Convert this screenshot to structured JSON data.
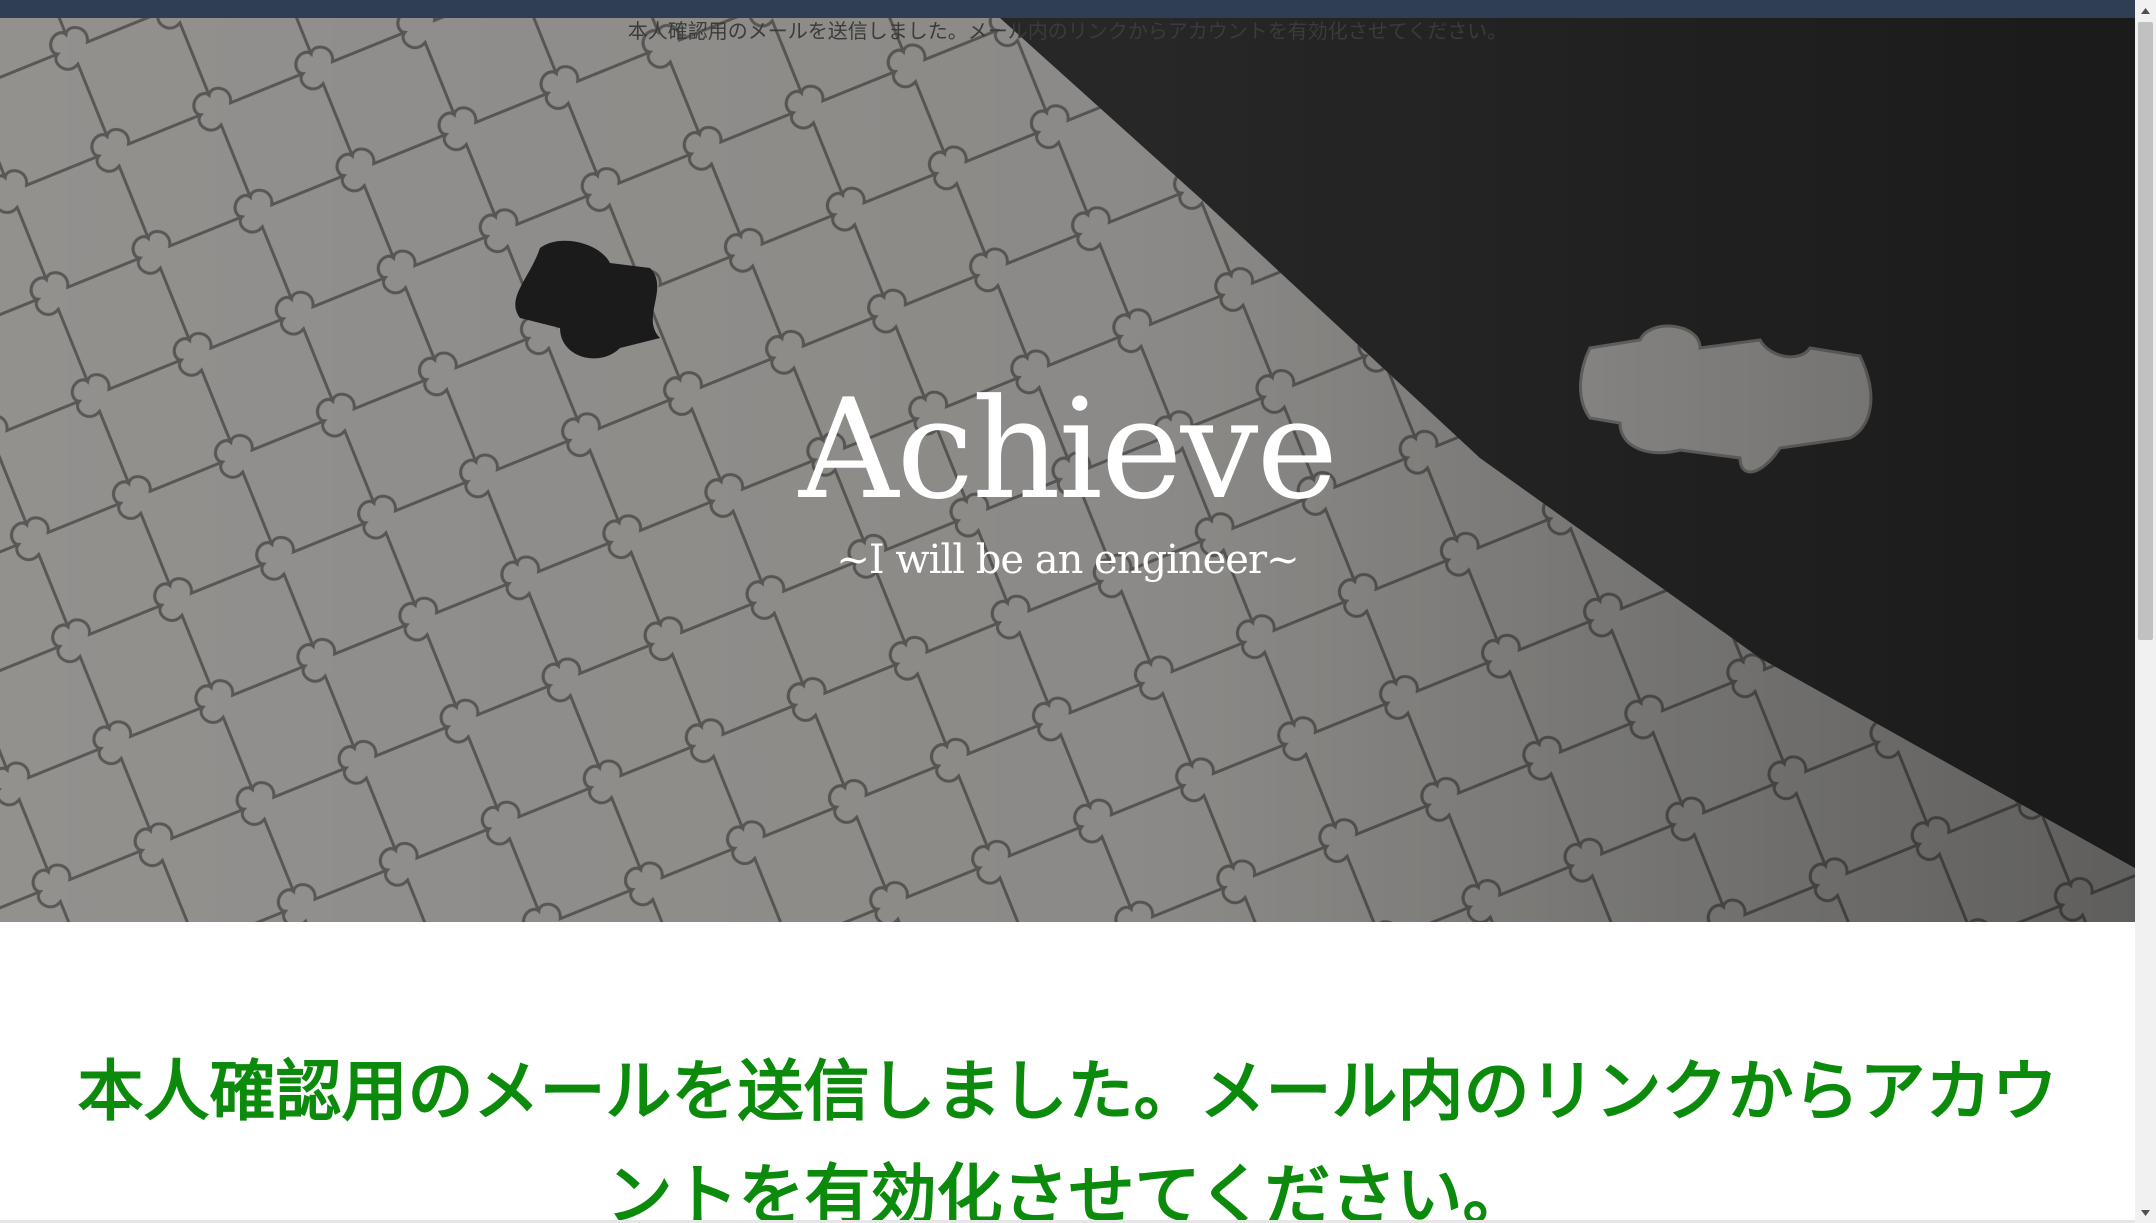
{
  "top_notice": "本人確認用のメールを送信しました。メール内のリンクからアカウントを有効化させてください。",
  "hero": {
    "title": "Achieve",
    "subtitle": "~I will be an engineer~",
    "image": "jigsaw-puzzle-photo"
  },
  "main_message": "本人確認用のメールを送信しました。メール内のリンクからアカウントを有効化させてください。",
  "colors": {
    "topbar": "#2f3e52",
    "message_green": "#0b8a0b",
    "hero_text": "#ffffff"
  },
  "icons": {
    "scroll_up": "triangle-up-icon",
    "scroll_down": "triangle-down-icon"
  }
}
